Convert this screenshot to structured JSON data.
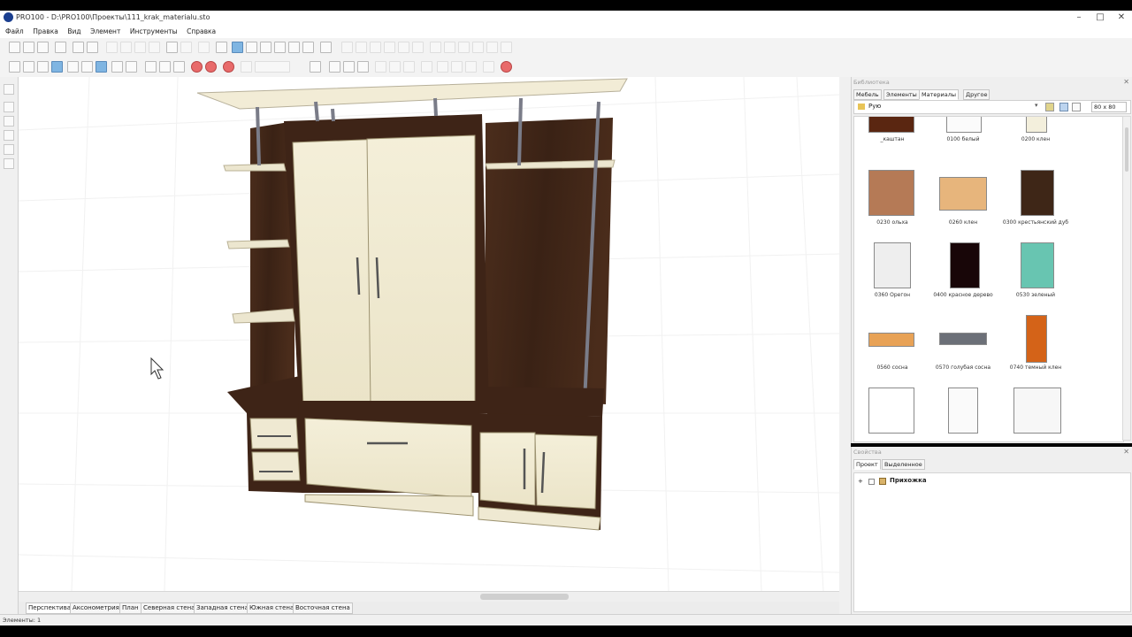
{
  "window": {
    "title": "PRO100 - D:\\PRO100\\Проекты\\111_krak_materialu.sto",
    "minimize": "–",
    "maximize": "□",
    "close": "✕"
  },
  "menu": [
    "Файл",
    "Правка",
    "Вид",
    "Элемент",
    "Инструменты",
    "Справка"
  ],
  "view_tabs": [
    {
      "label": "Перспектива",
      "active": true
    },
    {
      "label": "Аксонометрия",
      "active": false
    },
    {
      "label": "План",
      "active": false
    },
    {
      "label": "Северная стена",
      "active": false
    },
    {
      "label": "Западная стена",
      "active": false
    },
    {
      "label": "Южная стена",
      "active": false
    },
    {
      "label": "Восточная стена",
      "active": false
    }
  ],
  "library": {
    "title": "Библиотека",
    "tabs": [
      {
        "label": "Мебель",
        "active": false
      },
      {
        "label": "Элементы",
        "active": false
      },
      {
        "label": "Материалы",
        "active": true
      },
      {
        "label": "Другое",
        "active": false
      }
    ],
    "folder": "Рую",
    "size_option": "80 x 80",
    "materials": [
      {
        "name": "_каштан",
        "color": "#5a2611"
      },
      {
        "name": "0100 белый",
        "color": "#fbfbfb"
      },
      {
        "name": "0200 клен",
        "color": "#f3efdc"
      },
      {
        "name": "0230 ольха",
        "color": "#b57a56"
      },
      {
        "name": "0260 клен",
        "color": "#e7b57c"
      },
      {
        "name": "0300 крестьянский дуб",
        "color": "#3e2617"
      },
      {
        "name": "0360 Орегон",
        "color": "#eeeeee"
      },
      {
        "name": "0400 красное дерево",
        "color": "#180608"
      },
      {
        "name": "0530 зеленый",
        "color": "#68c5b1"
      },
      {
        "name": "0560 сосна",
        "color": "#e8a256"
      },
      {
        "name": "0570 голубая сосна",
        "color": "#6c7078"
      },
      {
        "name": "0740 темный клен",
        "color": "#d46318"
      },
      {
        "name": "",
        "color": "#ffffff"
      },
      {
        "name": "",
        "color": "#fafafa"
      },
      {
        "name": "",
        "color": "#f7f7f7"
      }
    ]
  },
  "properties": {
    "title": "Свойства",
    "tabs": [
      {
        "label": "Проект",
        "active": true
      },
      {
        "label": "Выделенное",
        "active": false
      }
    ],
    "tree": [
      {
        "label": "Прихожка",
        "expand": "+"
      }
    ]
  },
  "status": {
    "text": "Элементы: 1"
  }
}
